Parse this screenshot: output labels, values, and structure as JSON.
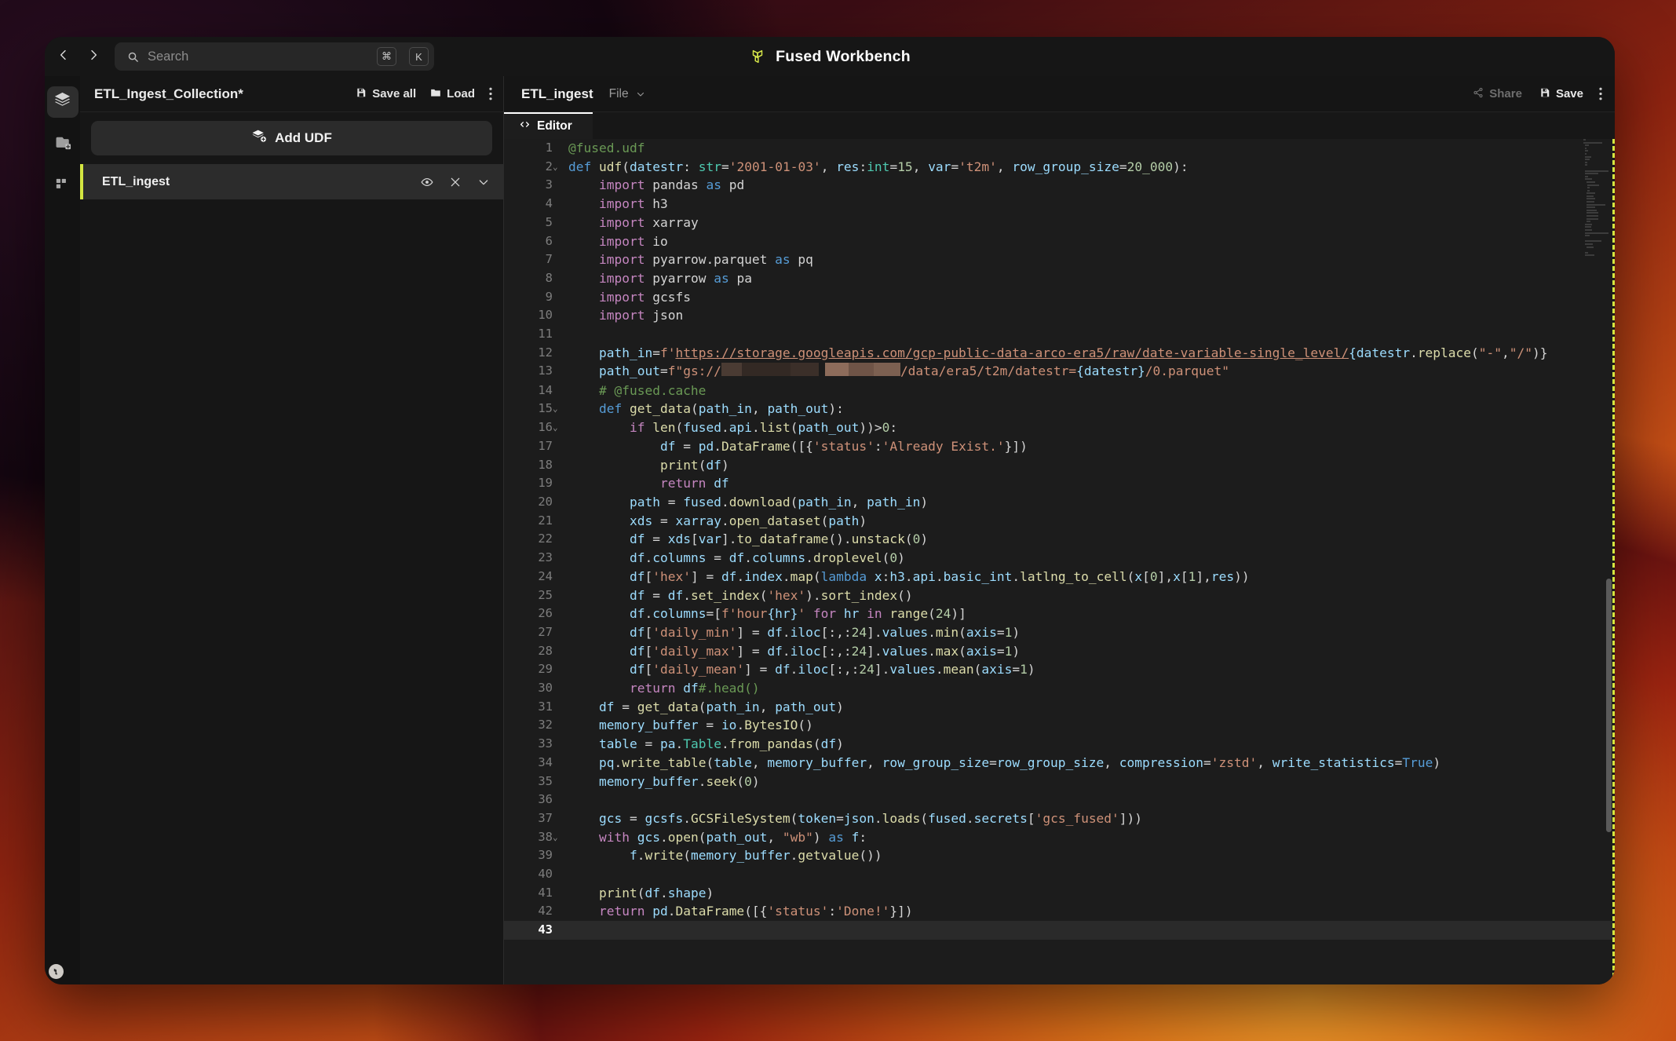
{
  "window": {
    "titlebar": {
      "back_icon": "chevron-left-icon",
      "forward_icon": "chevron-right-icon",
      "search": {
        "icon": "search-icon",
        "placeholder": "Search",
        "shortcut_keys": [
          "⌘",
          "K"
        ]
      },
      "app_title": "Fused Workbench",
      "app_logo_icon": "fused-logo-icon"
    }
  },
  "rail": {
    "items": [
      {
        "icon": "layers-icon",
        "name": "udf-collections",
        "active": true
      },
      {
        "icon": "folder-plus-icon",
        "name": "file-explorer",
        "active": false
      },
      {
        "icon": "apps-grid-icon",
        "name": "apps-grid",
        "active": false
      }
    ],
    "corner_logo_icon": "fused-corner-logo-icon"
  },
  "left_panel": {
    "title": "ETL_Ingest_Collection*",
    "save_all_label": "Save all",
    "save_all_icon": "save-icon",
    "load_label": "Load",
    "load_icon": "folder-icon",
    "kebab_icon": "kebab-menu-icon",
    "add_udf_label": "Add UDF",
    "add_udf_icon": "layers-plus-icon",
    "udfs": [
      {
        "name": "ETL_ingest",
        "eye_icon": "eye-icon",
        "close_icon": "close-icon",
        "chevron_icon": "chevron-down-icon",
        "selected": true
      }
    ]
  },
  "editor": {
    "name": "ETL_ingest",
    "file_menu_label": "File",
    "file_menu_caret_icon": "chevron-down-icon",
    "share_label": "Share",
    "share_icon": "share-icon",
    "save_label": "Save",
    "save_icon": "save-icon",
    "kebab_icon": "kebab-menu-icon",
    "tabs": [
      {
        "label": "Editor",
        "icon": "code-brackets-icon",
        "active": true
      }
    ],
    "current_line": 43,
    "total_lines": 43,
    "lines": [
      {
        "n": 1,
        "fold": "",
        "html": "<span class=\"t-dec\">@fused.udf</span>"
      },
      {
        "n": 2,
        "fold": "v",
        "html": "<span class=\"t-kw2\">def</span> <span class=\"t-fn\">udf</span>(<span class=\"t-var\">datestr</span>: <span class=\"t-cls\">str</span>=<span class=\"t-str\">'2001-01-03'</span>, <span class=\"t-var\">res</span>:<span class=\"t-cls\">int</span>=<span class=\"t-num\">15</span>, <span class=\"t-var\">var</span>=<span class=\"t-str\">'t2m'</span>, <span class=\"t-var\">row_group_size</span>=<span class=\"t-num\">20_000</span>):"
      },
      {
        "n": 3,
        "fold": "",
        "html": "    <span class=\"t-kw\">import</span> <span class=\"t-pl\">pandas</span> <span class=\"t-kw2\">as</span> <span class=\"t-pl\">pd</span>"
      },
      {
        "n": 4,
        "fold": "",
        "html": "    <span class=\"t-kw\">import</span> <span class=\"t-pl\">h3</span>"
      },
      {
        "n": 5,
        "fold": "",
        "html": "    <span class=\"t-kw\">import</span> <span class=\"t-pl\">xarray</span>"
      },
      {
        "n": 6,
        "fold": "",
        "html": "    <span class=\"t-kw\">import</span> <span class=\"t-pl\">io</span>"
      },
      {
        "n": 7,
        "fold": "",
        "html": "    <span class=\"t-kw\">import</span> <span class=\"t-pl\">pyarrow.parquet</span> <span class=\"t-kw2\">as</span> <span class=\"t-pl\">pq</span>"
      },
      {
        "n": 8,
        "fold": "",
        "html": "    <span class=\"t-kw\">import</span> <span class=\"t-pl\">pyarrow</span> <span class=\"t-kw2\">as</span> <span class=\"t-pl\">pa</span>"
      },
      {
        "n": 9,
        "fold": "",
        "html": "    <span class=\"t-kw\">import</span> <span class=\"t-pl\">gcsfs</span>"
      },
      {
        "n": 10,
        "fold": "",
        "html": "    <span class=\"t-kw\">import</span> <span class=\"t-pl\">json</span>"
      },
      {
        "n": 11,
        "fold": "",
        "html": ""
      },
      {
        "n": 12,
        "fold": "",
        "html": "    <span class=\"t-var\">path_in</span>=<span class=\"t-str\">f'</span><span class=\"t-url\">https://storage.googleapis.com/gcp-public-data-arco-era5/raw/date-variable-single_level/</span><span class=\"t-var\">{datestr</span>.<span class=\"t-fn\">replace</span>(<span class=\"t-str\">\"-\"</span>,<span class=\"t-str\">\"/\"</span>)}"
      },
      {
        "n": 13,
        "fold": "",
        "html": "    <span class=\"t-var\">path_out</span>=<span class=\"t-str\">f\"gs://</span><span class=\"redact\" data-redact=\"1\"></span><span class=\"t-str\">/data/era5/t2m/datestr=</span><span class=\"t-var\">{datestr}</span><span class=\"t-str\">/0.parquet\"</span>"
      },
      {
        "n": 14,
        "fold": "",
        "html": "    <span class=\"t-com\"># @fused.cache</span>"
      },
      {
        "n": 15,
        "fold": "v",
        "html": "    <span class=\"t-kw2\">def</span> <span class=\"t-fn\">get_data</span>(<span class=\"t-var\">path_in</span>, <span class=\"t-var\">path_out</span>):"
      },
      {
        "n": 16,
        "fold": "v",
        "html": "        <span class=\"t-kw\">if</span> <span class=\"t-fn\">len</span>(<span class=\"t-var\">fused</span>.<span class=\"t-var\">api</span>.<span class=\"t-fn\">list</span>(<span class=\"t-var\">path_out</span>))&gt;<span class=\"t-num\">0</span>:"
      },
      {
        "n": 17,
        "fold": "",
        "html": "            <span class=\"t-var\">df</span> = <span class=\"t-var\">pd</span>.<span class=\"t-fn\">DataFrame</span>([{<span class=\"t-str\">'status'</span>:<span class=\"t-str\">'Already Exist.'</span>}])"
      },
      {
        "n": 18,
        "fold": "",
        "html": "            <span class=\"t-fn\">print</span>(<span class=\"t-var\">df</span>)"
      },
      {
        "n": 19,
        "fold": "",
        "html": "            <span class=\"t-kw\">return</span> <span class=\"t-var\">df</span>"
      },
      {
        "n": 20,
        "fold": "",
        "html": "        <span class=\"t-var\">path</span> = <span class=\"t-var\">fused</span>.<span class=\"t-fn\">download</span>(<span class=\"t-var\">path_in</span>, <span class=\"t-var\">path_in</span>)"
      },
      {
        "n": 21,
        "fold": "",
        "html": "        <span class=\"t-var\">xds</span> = <span class=\"t-var\">xarray</span>.<span class=\"t-fn\">open_dataset</span>(<span class=\"t-var\">path</span>)"
      },
      {
        "n": 22,
        "fold": "",
        "html": "        <span class=\"t-var\">df</span> = <span class=\"t-var\">xds</span>[<span class=\"t-var\">var</span>].<span class=\"t-fn\">to_dataframe</span>().<span class=\"t-fn\">unstack</span>(<span class=\"t-num\">0</span>)"
      },
      {
        "n": 23,
        "fold": "",
        "html": "        <span class=\"t-var\">df</span>.<span class=\"t-var\">columns</span> = <span class=\"t-var\">df</span>.<span class=\"t-var\">columns</span>.<span class=\"t-fn\">droplevel</span>(<span class=\"t-num\">0</span>)"
      },
      {
        "n": 24,
        "fold": "",
        "html": "        <span class=\"t-var\">df</span>[<span class=\"t-str\">'hex'</span>] = <span class=\"t-var\">df</span>.<span class=\"t-var\">index</span>.<span class=\"t-fn\">map</span>(<span class=\"t-kw2\">lambda</span> <span class=\"t-var\">x</span>:<span class=\"t-var\">h3</span>.<span class=\"t-var\">api</span>.<span class=\"t-var\">basic_int</span>.<span class=\"t-fn\">latlng_to_cell</span>(<span class=\"t-var\">x</span>[<span class=\"t-num\">0</span>],<span class=\"t-var\">x</span>[<span class=\"t-num\">1</span>],<span class=\"t-var\">res</span>))"
      },
      {
        "n": 25,
        "fold": "",
        "html": "        <span class=\"t-var\">df</span> = <span class=\"t-var\">df</span>.<span class=\"t-fn\">set_index</span>(<span class=\"t-str\">'hex'</span>).<span class=\"t-fn\">sort_index</span>()"
      },
      {
        "n": 26,
        "fold": "",
        "html": "        <span class=\"t-var\">df</span>.<span class=\"t-var\">columns</span>=[<span class=\"t-str\">f'hour</span><span class=\"t-var\">{hr}</span><span class=\"t-str\">'</span> <span class=\"t-kw\">for</span> <span class=\"t-var\">hr</span> <span class=\"t-kw\">in</span> <span class=\"t-fn\">range</span>(<span class=\"t-num\">24</span>)]"
      },
      {
        "n": 27,
        "fold": "",
        "html": "        <span class=\"t-var\">df</span>[<span class=\"t-str\">'daily_min'</span>] = <span class=\"t-var\">df</span>.<span class=\"t-var\">iloc</span>[:,:<span class=\"t-num\">24</span>].<span class=\"t-var\">values</span>.<span class=\"t-fn\">min</span>(<span class=\"t-var\">axis</span>=<span class=\"t-num\">1</span>)"
      },
      {
        "n": 28,
        "fold": "",
        "html": "        <span class=\"t-var\">df</span>[<span class=\"t-str\">'daily_max'</span>] = <span class=\"t-var\">df</span>.<span class=\"t-var\">iloc</span>[:,:<span class=\"t-num\">24</span>].<span class=\"t-var\">values</span>.<span class=\"t-fn\">max</span>(<span class=\"t-var\">axis</span>=<span class=\"t-num\">1</span>)"
      },
      {
        "n": 29,
        "fold": "",
        "html": "        <span class=\"t-var\">df</span>[<span class=\"t-str\">'daily_mean'</span>] = <span class=\"t-var\">df</span>.<span class=\"t-var\">iloc</span>[:,:<span class=\"t-num\">24</span>].<span class=\"t-var\">values</span>.<span class=\"t-fn\">mean</span>(<span class=\"t-var\">axis</span>=<span class=\"t-num\">1</span>)"
      },
      {
        "n": 30,
        "fold": "",
        "html": "        <span class=\"t-kw\">return</span> <span class=\"t-var\">df</span><span class=\"t-com\">#.head()</span>"
      },
      {
        "n": 31,
        "fold": "",
        "html": "    <span class=\"t-var\">df</span> = <span class=\"t-fn\">get_data</span>(<span class=\"t-var\">path_in</span>, <span class=\"t-var\">path_out</span>)"
      },
      {
        "n": 32,
        "fold": "",
        "html": "    <span class=\"t-var\">memory_buffer</span> = <span class=\"t-var\">io</span>.<span class=\"t-fn\">BytesIO</span>()"
      },
      {
        "n": 33,
        "fold": "",
        "html": "    <span class=\"t-var\">table</span> = <span class=\"t-var\">pa</span>.<span class=\"t-cls\">Table</span>.<span class=\"t-fn\">from_pandas</span>(<span class=\"t-var\">df</span>)"
      },
      {
        "n": 34,
        "fold": "",
        "html": "    <span class=\"t-var\">pq</span>.<span class=\"t-fn\">write_table</span>(<span class=\"t-var\">table</span>, <span class=\"t-var\">memory_buffer</span>, <span class=\"t-var\">row_group_size</span>=<span class=\"t-var\">row_group_size</span>, <span class=\"t-var\">compression</span>=<span class=\"t-str\">'zstd'</span>, <span class=\"t-var\">write_statistics</span>=<span class=\"t-kw2\">True</span>)"
      },
      {
        "n": 35,
        "fold": "",
        "html": "    <span class=\"t-var\">memory_buffer</span>.<span class=\"t-fn\">seek</span>(<span class=\"t-num\">0</span>)"
      },
      {
        "n": 36,
        "fold": "",
        "html": ""
      },
      {
        "n": 37,
        "fold": "",
        "html": "    <span class=\"t-var\">gcs</span> = <span class=\"t-var\">gcsfs</span>.<span class=\"t-fn\">GCSFileSystem</span>(<span class=\"t-var\">token</span>=<span class=\"t-var\">json</span>.<span class=\"t-fn\">loads</span>(<span class=\"t-var\">fused</span>.<span class=\"t-var\">secrets</span>[<span class=\"t-str\">'gcs_fused'</span>]))"
      },
      {
        "n": 38,
        "fold": "v",
        "html": "    <span class=\"t-kw\">with</span> <span class=\"t-var\">gcs</span>.<span class=\"t-fn\">open</span>(<span class=\"t-var\">path_out</span>, <span class=\"t-str\">\"wb\"</span>) <span class=\"t-kw2\">as</span> <span class=\"t-var\">f</span>:"
      },
      {
        "n": 39,
        "fold": "",
        "html": "        <span class=\"t-var\">f</span>.<span class=\"t-fn\">write</span>(<span class=\"t-var\">memory_buffer</span>.<span class=\"t-fn\">getvalue</span>())"
      },
      {
        "n": 40,
        "fold": "",
        "html": ""
      },
      {
        "n": 41,
        "fold": "",
        "html": "    <span class=\"t-fn\">print</span>(<span class=\"t-var\">df</span>.<span class=\"t-var\">shape</span>)"
      },
      {
        "n": 42,
        "fold": "",
        "html": "    <span class=\"t-kw\">return</span> <span class=\"t-var\">pd</span>.<span class=\"t-fn\">DataFrame</span>([{<span class=\"t-str\">'status'</span>:<span class=\"t-str\">'Done!'</span>}])"
      },
      {
        "n": 43,
        "fold": "",
        "html": ""
      }
    ]
  },
  "colors": {
    "accent_lime": "#d4e641",
    "panel_bg": "#161616",
    "editor_bg": "#1c1c1c",
    "active_tab_border": "#ffffff"
  }
}
